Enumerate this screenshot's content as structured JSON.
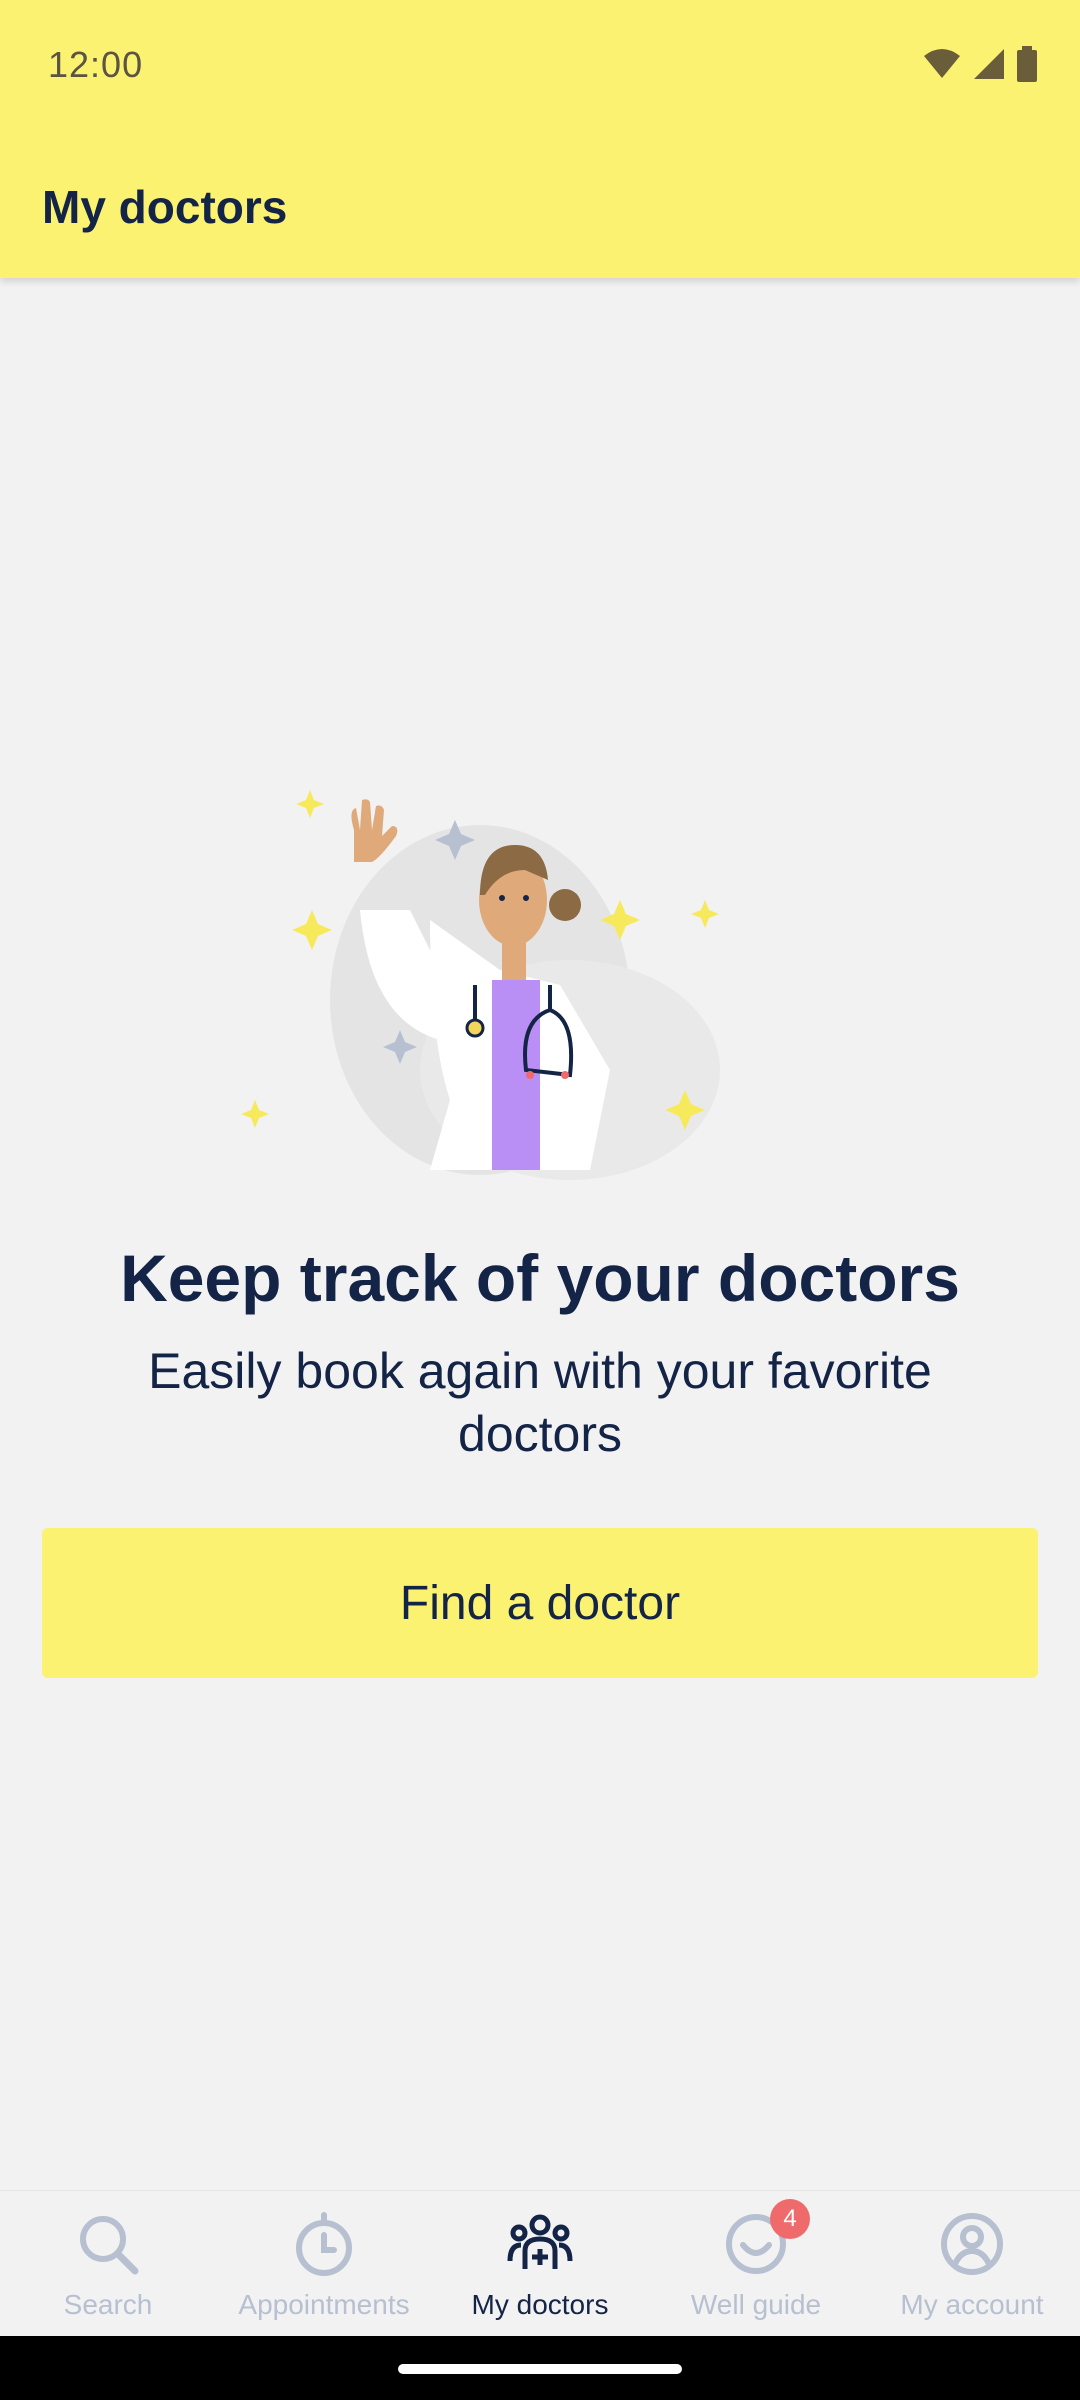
{
  "status_bar": {
    "time": "12:00",
    "icons": [
      "wifi-icon",
      "signal-icon",
      "battery-icon"
    ]
  },
  "header": {
    "title": "My doctors"
  },
  "empty_state": {
    "illustration": "doctor-waving-illustration",
    "headline": "Keep track of your doctors",
    "subtitle": "Easily book again with your favorite doctors",
    "cta_label": "Find a doctor"
  },
  "bottom_nav": {
    "items": [
      {
        "label": "Search",
        "icon": "search-icon",
        "active": false
      },
      {
        "label": "Appointments",
        "icon": "clock-icon",
        "active": false
      },
      {
        "label": "My doctors",
        "icon": "doctors-group-icon",
        "active": true
      },
      {
        "label": "Well guide",
        "icon": "smile-icon",
        "active": false,
        "badge": "4"
      },
      {
        "label": "My account",
        "icon": "account-icon",
        "active": false
      }
    ]
  },
  "colors": {
    "accent": "#fbf271",
    "text": "#142447",
    "inactive": "#b7c0d1",
    "badge": "#ef6b6b"
  }
}
